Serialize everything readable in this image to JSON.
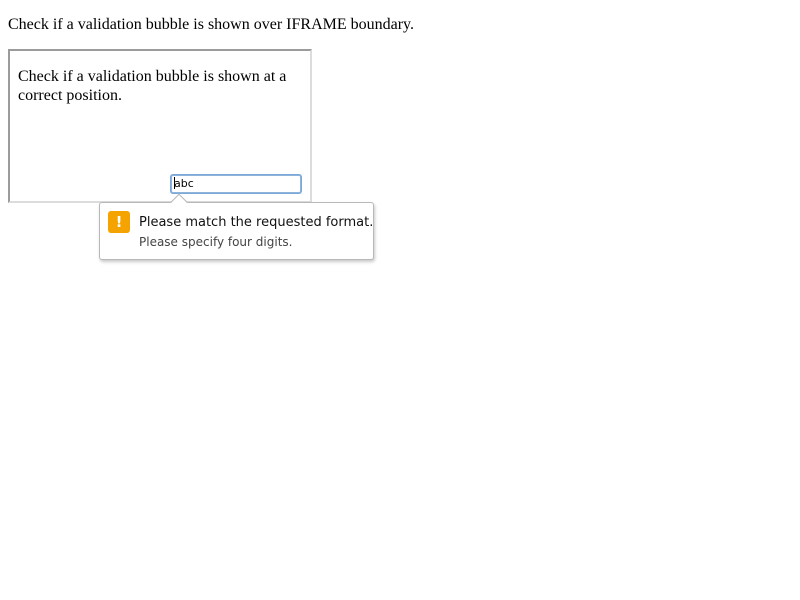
{
  "page": {
    "heading": "Check if a validation bubble is shown over IFRAME boundary."
  },
  "iframe": {
    "text": "Check if a validation bubble is shown at a correct position.",
    "input_value": "abc"
  },
  "validation_bubble": {
    "icon": "warning-icon",
    "icon_glyph": "!",
    "icon_color": "#f5a300",
    "title": "Please match the requested format.",
    "detail": "Please specify four digits."
  }
}
